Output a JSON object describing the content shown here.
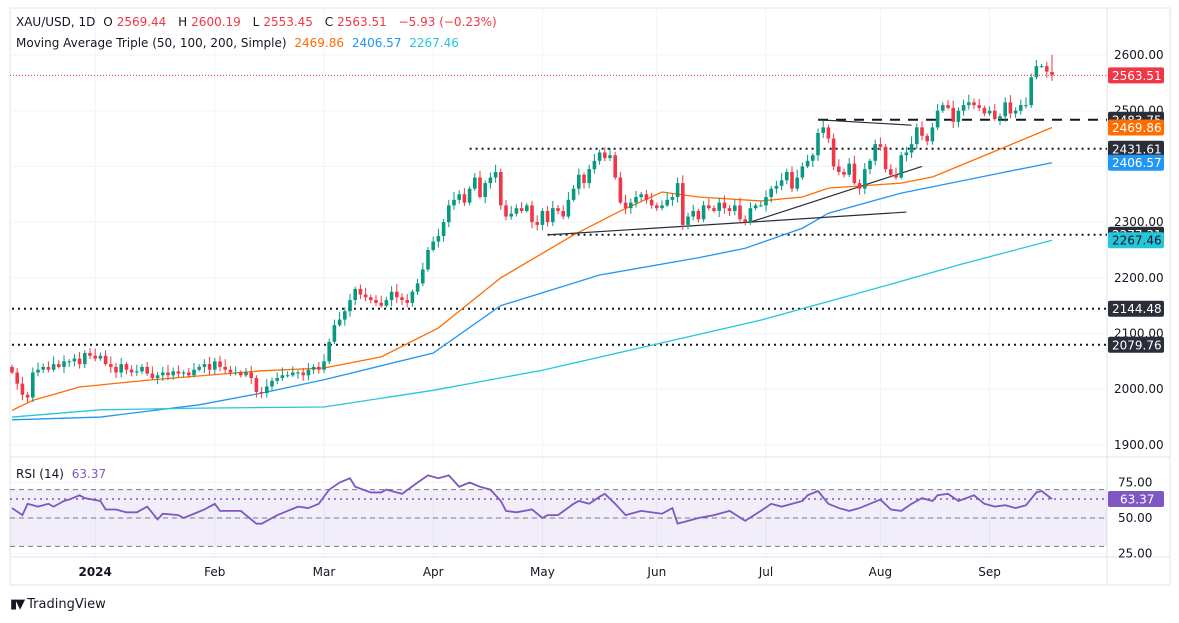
{
  "header": {
    "symbol": "XAU/USD, 1D",
    "open_label": "O",
    "open": "2569.44",
    "high_label": "H",
    "high": "2600.19",
    "low_label": "L",
    "low": "2553.45",
    "close_label": "C",
    "close": "2563.51",
    "change": "−5.93 (−0.23%)",
    "ma_title": "Moving Average Triple (50, 100, 200, Simple)",
    "ma50": "2469.86",
    "ma100": "2406.57",
    "ma200": "2267.46"
  },
  "rsi_header": {
    "title": "RSI (14)",
    "value": "63.37"
  },
  "branding": "TradingView",
  "colors": {
    "up": "#089981",
    "down": "#f23645",
    "ma50": "#ff6d00",
    "ma100": "#2196f3",
    "ma200": "#26c6da",
    "rsi": "#7e57c2",
    "level_badge": "#2a2e39"
  },
  "chart_data": [
    {
      "type": "candlestick",
      "title": "XAU/USD, 1D",
      "ylim": [
        1880,
        2620
      ],
      "y_ticks": [
        1900,
        2000,
        2100,
        2200,
        2300,
        2400,
        2500,
        2600
      ],
      "x_ticks": [
        {
          "bar": 16,
          "label": "2024"
        },
        {
          "bar": 39,
          "label": "Feb"
        },
        {
          "bar": 60,
          "label": "Mar"
        },
        {
          "bar": 81,
          "label": "Apr"
        },
        {
          "bar": 102,
          "label": "May"
        },
        {
          "bar": 124,
          "label": "Jun"
        },
        {
          "bar": 145,
          "label": "Jul"
        },
        {
          "bar": 167,
          "label": "Aug"
        },
        {
          "bar": 188,
          "label": "Sep"
        }
      ],
      "grid": true,
      "closes": [
        2030,
        2010,
        1990,
        1985,
        2030,
        2035,
        2040,
        2035,
        2045,
        2040,
        2050,
        2050,
        2055,
        2045,
        2065,
        2060,
        2055,
        2060,
        2045,
        2040,
        2030,
        2045,
        2035,
        2030,
        2032,
        2040,
        2028,
        2020,
        2025,
        2030,
        2025,
        2032,
        2028,
        2030,
        2025,
        2035,
        2040,
        2045,
        2035,
        2050,
        2040,
        2035,
        2030,
        2030,
        2025,
        2030,
        2020,
        1995,
        1993,
        2005,
        2015,
        2020,
        2025,
        2025,
        2030,
        2030,
        2025,
        2035,
        2040,
        2035,
        2050,
        2085,
        2115,
        2125,
        2140,
        2160,
        2180,
        2170,
        2165,
        2160,
        2155,
        2150,
        2160,
        2175,
        2165,
        2160,
        2155,
        2175,
        2190,
        2215,
        2250,
        2265,
        2275,
        2300,
        2330,
        2340,
        2350,
        2335,
        2360,
        2380,
        2345,
        2370,
        2380,
        2390,
        2330,
        2310,
        2315,
        2325,
        2320,
        2330,
        2300,
        2295,
        2320,
        2300,
        2325,
        2320,
        2310,
        2340,
        2360,
        2385,
        2370,
        2395,
        2410,
        2425,
        2415,
        2420,
        2380,
        2335,
        2325,
        2335,
        2345,
        2350,
        2340,
        2330,
        2325,
        2330,
        2340,
        2345,
        2370,
        2295,
        2310,
        2320,
        2305,
        2330,
        2325,
        2320,
        2335,
        2325,
        2320,
        2330,
        2305,
        2300,
        2325,
        2330,
        2330,
        2345,
        2360,
        2365,
        2375,
        2390,
        2360,
        2380,
        2400,
        2410,
        2420,
        2460,
        2470,
        2450,
        2400,
        2390,
        2385,
        2405,
        2370,
        2360,
        2395,
        2410,
        2440,
        2435,
        2395,
        2385,
        2380,
        2420,
        2425,
        2440,
        2470,
        2455,
        2445,
        2470,
        2500,
        2510,
        2505,
        2480,
        2500,
        2510,
        2515,
        2510,
        2505,
        2495,
        2500,
        2485,
        2490,
        2515,
        2495,
        2500,
        2510,
        2510,
        2560,
        2580,
        2580,
        2570,
        2563.51
      ],
      "last_bar": {
        "open": 2569.44,
        "high": 2600.19,
        "low": 2553.45,
        "close": 2563.51
      },
      "series": [
        {
          "name": "MA 50",
          "color": "#ff6d00",
          "points": [
            [
              0,
              1962
            ],
            [
              4,
              1980
            ],
            [
              13,
              2004
            ],
            [
              27,
              2017
            ],
            [
              48,
              2033
            ],
            [
              60,
              2038
            ],
            [
              71,
              2058
            ],
            [
              82,
              2110
            ],
            [
              94,
              2200
            ],
            [
              108,
              2277
            ],
            [
              117,
              2320
            ],
            [
              125,
              2354
            ],
            [
              132,
              2345
            ],
            [
              144,
              2338
            ],
            [
              152,
              2345
            ],
            [
              157,
              2361
            ],
            [
              171,
              2370
            ],
            [
              177,
              2381
            ],
            [
              190,
              2431
            ],
            [
              200,
              2469.86
            ]
          ]
        },
        {
          "name": "MA 100",
          "color": "#2196f3",
          "points": [
            [
              0,
              1945
            ],
            [
              17,
              1950
            ],
            [
              36,
              1972
            ],
            [
              48,
              1993
            ],
            [
              60,
              2017
            ],
            [
              81,
              2065
            ],
            [
              94,
              2150
            ],
            [
              113,
              2205
            ],
            [
              132,
              2236
            ],
            [
              141,
              2253
            ],
            [
              152,
              2289
            ],
            [
              157,
              2316
            ],
            [
              171,
              2352
            ],
            [
              190,
              2388
            ],
            [
              200,
              2406.57
            ]
          ]
        },
        {
          "name": "MA 200",
          "color": "#26c6da",
          "points": [
            [
              0,
              1950
            ],
            [
              17,
              1963
            ],
            [
              36,
              1966
            ],
            [
              60,
              1968
            ],
            [
              81,
              1998
            ],
            [
              102,
              2034
            ],
            [
              123,
              2079
            ],
            [
              144,
              2124
            ],
            [
              165,
              2178
            ],
            [
              182,
              2223
            ],
            [
              200,
              2267.46
            ]
          ]
        }
      ],
      "price_levels": [
        {
          "value": 2483.75,
          "label": "2483.75",
          "style": "dashed",
          "from_bar": 155
        },
        {
          "value": 2431.61,
          "label": "2431.61",
          "style": "dotted",
          "from_bar": 88
        },
        {
          "value": 2277.31,
          "label": "2277.31",
          "style": "dotted",
          "from_bar": 103
        },
        {
          "value": 2144.48,
          "label": "2144.48",
          "style": "dotted",
          "from_bar": 0
        },
        {
          "value": 2079.76,
          "label": "2079.76",
          "style": "dotted",
          "from_bar": 0
        }
      ],
      "trend_lines": [
        [
          [
            103,
            2277
          ],
          [
            142,
            2300
          ]
        ],
        [
          [
            142,
            2300
          ],
          [
            172,
            2318
          ]
        ],
        [
          [
            142,
            2300
          ],
          [
            175,
            2400
          ]
        ],
        [
          [
            155,
            2483.75
          ],
          [
            173,
            2474
          ]
        ]
      ],
      "price_badges": [
        {
          "label": "2563.51",
          "value": 2563.51,
          "color": "#f23645"
        },
        {
          "label": "2483.75",
          "value": 2483.75,
          "color": "#2a2e39"
        },
        {
          "label": "2469.86",
          "value": 2469.86,
          "color": "#ff6d00"
        },
        {
          "label": "2431.61",
          "value": 2431.61,
          "color": "#2a2e39"
        },
        {
          "label": "2406.57",
          "value": 2406.57,
          "color": "#2196f3"
        },
        {
          "label": "2277.31",
          "value": 2277.31,
          "color": "#2a2e39"
        },
        {
          "label": "2267.46",
          "value": 2267.46,
          "color": "#26c6da"
        },
        {
          "label": "2144.48",
          "value": 2144.48,
          "color": "#2a2e39"
        },
        {
          "label": "2079.76",
          "value": 2079.76,
          "color": "#2a2e39"
        }
      ]
    },
    {
      "type": "line",
      "title": "RSI (14)",
      "ylim": [
        20,
        85
      ],
      "y_ticks": [
        25,
        50,
        75
      ],
      "bands": {
        "upper": 70,
        "middle": 50,
        "lower": 30
      },
      "points": [
        [
          0,
          57
        ],
        [
          2,
          52
        ],
        [
          3,
          60
        ],
        [
          5,
          58
        ],
        [
          7,
          60
        ],
        [
          8,
          58
        ],
        [
          10,
          62
        ],
        [
          11,
          63
        ],
        [
          13,
          66
        ],
        [
          14,
          64
        ],
        [
          17,
          62
        ],
        [
          18,
          56
        ],
        [
          20,
          56
        ],
        [
          22,
          54
        ],
        [
          24,
          54
        ],
        [
          26,
          58
        ],
        [
          28,
          49
        ],
        [
          29,
          53
        ],
        [
          32,
          52
        ],
        [
          33,
          50
        ],
        [
          35,
          53
        ],
        [
          37,
          56
        ],
        [
          39,
          60
        ],
        [
          40,
          55
        ],
        [
          44,
          55
        ],
        [
          47,
          46
        ],
        [
          48,
          46
        ],
        [
          51,
          52
        ],
        [
          53,
          55
        ],
        [
          55,
          58
        ],
        [
          57,
          57
        ],
        [
          59,
          60
        ],
        [
          61,
          70
        ],
        [
          63,
          75
        ],
        [
          65,
          78
        ],
        [
          66,
          72
        ],
        [
          69,
          68
        ],
        [
          71,
          68
        ],
        [
          72,
          70
        ],
        [
          75,
          67
        ],
        [
          78,
          75
        ],
        [
          80,
          80
        ],
        [
          82,
          78
        ],
        [
          84,
          80
        ],
        [
          86,
          72
        ],
        [
          88,
          75
        ],
        [
          90,
          72
        ],
        [
          92,
          70
        ],
        [
          94,
          62
        ],
        [
          95,
          55
        ],
        [
          97,
          54
        ],
        [
          100,
          56
        ],
        [
          102,
          50
        ],
        [
          103,
          52
        ],
        [
          105,
          52
        ],
        [
          108,
          60
        ],
        [
          109,
          62
        ],
        [
          111,
          60
        ],
        [
          113,
          65
        ],
        [
          114,
          67
        ],
        [
          116,
          60
        ],
        [
          118,
          52
        ],
        [
          121,
          55
        ],
        [
          125,
          53
        ],
        [
          127,
          57
        ],
        [
          128,
          46
        ],
        [
          130,
          48
        ],
        [
          132,
          50
        ],
        [
          135,
          52
        ],
        [
          138,
          55
        ],
        [
          141,
          48
        ],
        [
          144,
          55
        ],
        [
          146,
          60
        ],
        [
          148,
          58
        ],
        [
          152,
          62
        ],
        [
          153,
          66
        ],
        [
          155,
          69
        ],
        [
          157,
          60
        ],
        [
          159,
          57
        ],
        [
          161,
          55
        ],
        [
          163,
          57
        ],
        [
          165,
          60
        ],
        [
          167,
          63
        ],
        [
          169,
          56
        ],
        [
          171,
          55
        ],
        [
          173,
          60
        ],
        [
          175,
          64
        ],
        [
          177,
          62
        ],
        [
          178,
          66
        ],
        [
          180,
          67
        ],
        [
          182,
          62
        ],
        [
          185,
          66
        ],
        [
          187,
          60
        ],
        [
          189,
          58
        ],
        [
          191,
          59
        ],
        [
          193,
          57
        ],
        [
          195,
          59
        ],
        [
          197,
          68
        ],
        [
          198,
          69
        ],
        [
          200,
          63.37
        ]
      ]
    }
  ]
}
